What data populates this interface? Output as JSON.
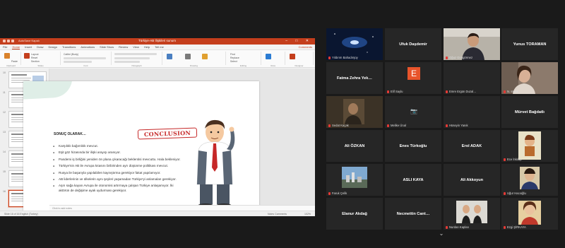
{
  "powerpoint": {
    "autosave": "AutoSave  Kapalı",
    "doc_title": "Türkiye-AB İlişkileri sunum",
    "window_controls": "–  □  ✕",
    "tabs": [
      "File",
      "Home",
      "Insert",
      "Draw",
      "Design",
      "Transitions",
      "Animations",
      "Slide Show",
      "Review",
      "View",
      "Help",
      "Tell me"
    ],
    "active_tab": "Home",
    "comments": "Comments",
    "ribbon_labels": [
      "Paste",
      "New Slide",
      "Layout",
      "Reset",
      "Section",
      "Calibri (Body)",
      "Shapes",
      "Arrange",
      "Quick Styles",
      "Find",
      "Replace",
      "Select",
      "Dictate",
      "Design Ideas"
    ],
    "ribbon_groups": [
      "Clipboard",
      "Slides",
      "Font",
      "Paragraph",
      "Drawing",
      "Editing",
      "Voice",
      "Designer"
    ],
    "thumbnail_numbers": [
      "10",
      "11",
      "12",
      "13",
      "14",
      "15",
      "16"
    ],
    "notes_placeholder": "Click to add notes",
    "status_left": "Slide 16 of 16    English (Turkey)",
    "status_right": "Notes    Comments",
    "zoom": "102%"
  },
  "slide": {
    "heading": "SONUÇ OLARAK…",
    "badge": "CONCLUSION",
    "bullets": [
      "Karşılıklı bağımlılık mevcut.",
      "Eşit göz hizasında bir ilişki arayışı aranıyor.",
      "Pandemi iş birliğini yeniden ön plana çıkaracağı beklentisi mevcuttu. Hala bekleniyor.",
      "Türkiye'nin AB ile Avrupa kıtasını birbirinden ayrı düşünme politikası mevcut.",
      "Rusya ile başarıyla yapılabilen kaynıştırma gerekiyor fakat yapılamıyor.",
      "AB liderlerinin ve ülkelerin aynı şeyleri yaşamadan Türkiye'yi anlamaları gerekiyor.",
      "Aşırı sağa kayan Avrupa ile otonomisi artırmaya çalışan Türkiye anlaşamıyor. İki aktörün de değişime ayak uydurması gerekiyor."
    ]
  },
  "participants": [
    {
      "name": "Yıldırım Bahadırşoy",
      "style": "galaxy",
      "muted": true
    },
    {
      "name": "Ufuk Daşdemir",
      "style": "name",
      "muted": false
    },
    {
      "name": "Oğuz Güngörmez",
      "style": "video-man",
      "muted": true,
      "speaking": true
    },
    {
      "name": "Yunus TORAMAN",
      "style": "name",
      "muted": false
    },
    {
      "name": "Fatma Zehra Yek…",
      "style": "name",
      "muted": false
    },
    {
      "name": "Elif Saylu",
      "style": "letter",
      "letter": "E",
      "muted": true
    },
    {
      "name": "Emre Ergün Duzal…",
      "style": "blank",
      "muted": true
    },
    {
      "name": "N. Irmak",
      "style": "video-woman",
      "muted": true
    },
    {
      "name": "Sedat Kaçak",
      "style": "video-dim",
      "muted": true
    },
    {
      "name": "Melike Ünal",
      "style": "camoff",
      "muted": true
    },
    {
      "name": "Hüseyin Yanık",
      "style": "blank",
      "muted": true
    },
    {
      "name": "Mürvet Bağdatlı",
      "style": "name",
      "muted": false
    },
    {
      "name": "Ali ÖZKAN",
      "style": "name",
      "muted": false
    },
    {
      "name": "Enes Türkoğlu",
      "style": "name",
      "muted": false
    },
    {
      "name": "Erol ADAK",
      "style": "name",
      "muted": false
    },
    {
      "name": "Ece İnkılap",
      "style": "video-cartoon",
      "muted": true
    },
    {
      "name": "Faruk Çelik",
      "style": "video-city",
      "muted": true
    },
    {
      "name": "ASLI KAYA",
      "style": "name",
      "muted": false
    },
    {
      "name": "Ali Akkoyun",
      "style": "name",
      "muted": false
    },
    {
      "name": "Uğur Hacıoğlu",
      "style": "video-avatar",
      "muted": true
    },
    {
      "name": "Elanur Akdağ",
      "style": "name",
      "muted": false
    },
    {
      "name": "Necmettin Cant…",
      "style": "name",
      "muted": false
    },
    {
      "name": "Nurdan Kaplan",
      "style": "video-pair",
      "muted": true
    },
    {
      "name": "Ezgi ŞİRKAYA",
      "style": "video-girl",
      "muted": true
    }
  ],
  "gallery": {
    "scroll_icon": "⌄"
  }
}
